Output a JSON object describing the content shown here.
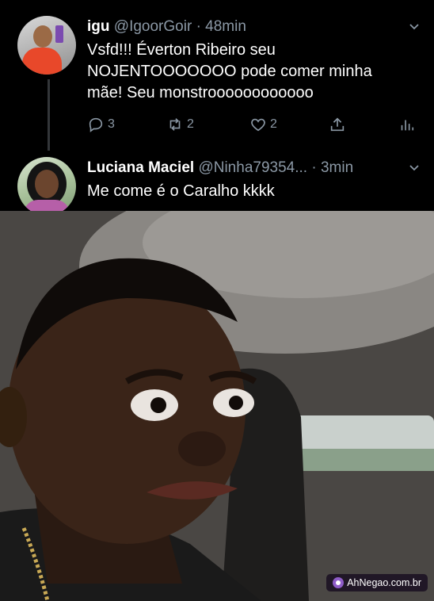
{
  "tweets": [
    {
      "name": "igu",
      "handle": "@IgoorGoir",
      "separator": "·",
      "time": "48min",
      "lines": [
        "Vsfd!!! Éverton Ribeiro seu",
        "NOJENTOOOOOOO pode comer  minha",
        "mãe! Seu monstroooooooooooo"
      ],
      "actions": {
        "replies": "3",
        "retweets": "2",
        "likes": "2"
      }
    },
    {
      "name": "Luciana Maciel",
      "handle": "@Ninha79354...",
      "separator": "·",
      "time": "3min",
      "lines": [
        "Me come é  o Caralho kkkk"
      ]
    }
  ],
  "icons": {
    "reply": "reply-icon",
    "retweet": "retweet-icon",
    "like": "heart-icon",
    "share": "share-icon",
    "stats": "stats-icon",
    "more": "chevron-down-icon"
  },
  "watermark": {
    "text": "AhNegao.com.br"
  },
  "colors": {
    "background": "#000000",
    "muted": "#8b98a5",
    "text": "#ffffff"
  }
}
